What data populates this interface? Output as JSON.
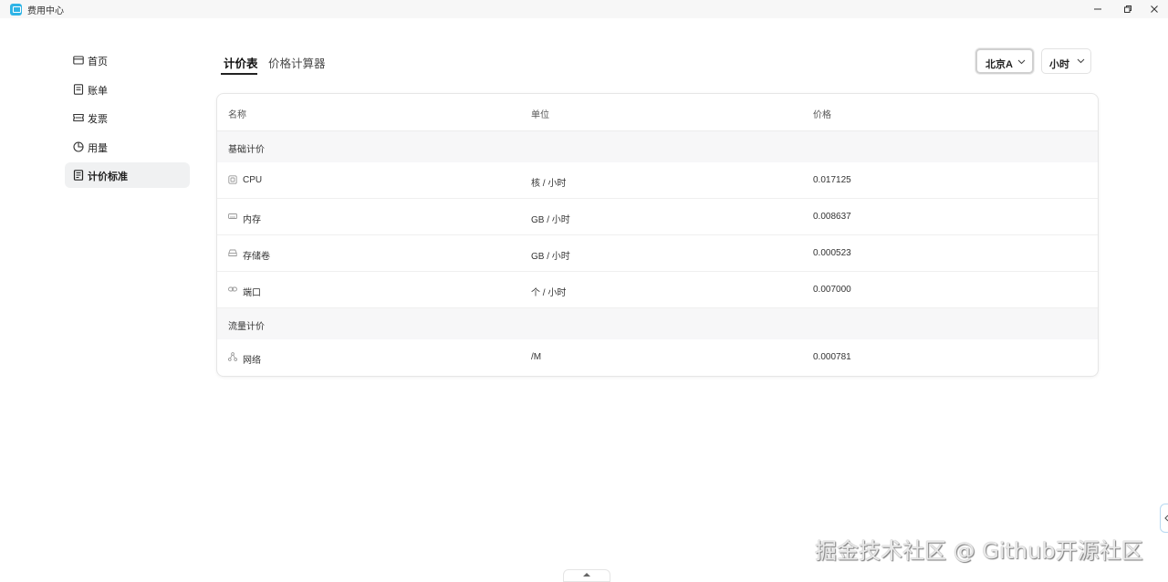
{
  "window": {
    "title": "费用中心"
  },
  "sidebar": {
    "items": [
      {
        "label": "首页",
        "icon": "card-icon"
      },
      {
        "label": "账单",
        "icon": "document-icon"
      },
      {
        "label": "发票",
        "icon": "ticket-icon"
      },
      {
        "label": "用量",
        "icon": "pie-chart-icon"
      },
      {
        "label": "计价标准",
        "icon": "list-document-icon",
        "active": true
      }
    ]
  },
  "tabs": [
    {
      "label": "计价表",
      "active": true
    },
    {
      "label": "价格计算器",
      "active": false
    }
  ],
  "filters": {
    "region": "北京A",
    "unit": "小时"
  },
  "table": {
    "headers": [
      "名称",
      "单位",
      "价格"
    ],
    "sections": [
      {
        "title": "基础计价",
        "rows": [
          {
            "icon": "cpu-icon",
            "name": "CPU",
            "unit": "核 / 小时",
            "price": "0.017125"
          },
          {
            "icon": "memory-icon",
            "name": "内存",
            "unit": "GB / 小时",
            "price": "0.008637"
          },
          {
            "icon": "storage-icon",
            "name": "存储卷",
            "unit": "GB / 小时",
            "price": "0.000523"
          },
          {
            "icon": "link-icon",
            "name": "端口",
            "unit": "个 / 小时",
            "price": "0.007000"
          }
        ]
      },
      {
        "title": "流量计价",
        "rows": [
          {
            "icon": "network-icon",
            "name": "网络",
            "unit": "/M",
            "price": "0.000781"
          }
        ]
      }
    ]
  },
  "watermark": "掘金技术社区 @ Github开源社区",
  "colors": {
    "accent": "#2fb4e6",
    "active_bg": "#f0f1f2"
  }
}
